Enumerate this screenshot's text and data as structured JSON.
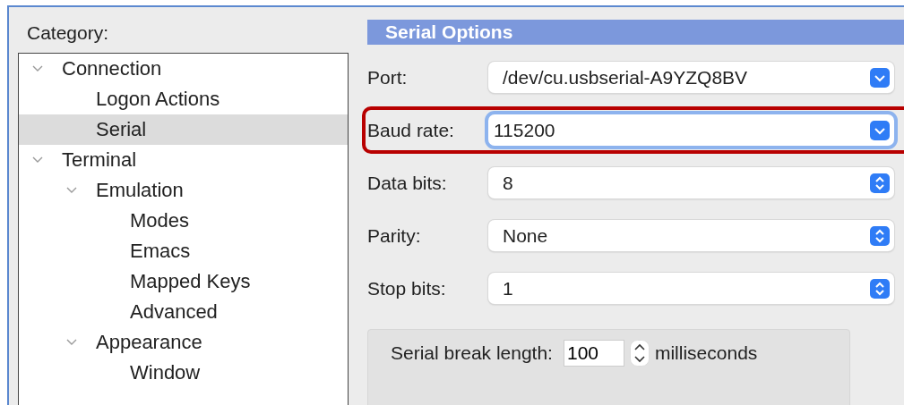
{
  "category": {
    "label": "Category:",
    "tree": [
      {
        "label": "Connection",
        "expanded": true,
        "selected": false,
        "children": [
          {
            "label": "Logon Actions",
            "selected": false
          },
          {
            "label": "Serial",
            "selected": true
          }
        ]
      },
      {
        "label": "Terminal",
        "expanded": true,
        "selected": false,
        "children": [
          {
            "label": "Emulation",
            "expanded": true,
            "selected": false,
            "children": [
              {
                "label": "Modes",
                "selected": false
              },
              {
                "label": "Emacs",
                "selected": false
              },
              {
                "label": "Mapped Keys",
                "selected": false
              },
              {
                "label": "Advanced",
                "selected": false
              }
            ]
          },
          {
            "label": "Appearance",
            "expanded": true,
            "selected": false,
            "children": [
              {
                "label": "Window",
                "selected": false
              }
            ]
          }
        ]
      }
    ]
  },
  "panel": {
    "title": "Serial Options",
    "fields": [
      {
        "label": "Port:",
        "value": "/dev/cu.usbserial-A9YZQ8BV",
        "kind": "combo",
        "focused": false,
        "highlighted": false
      },
      {
        "label": "Baud rate:",
        "value": "115200",
        "kind": "combo",
        "focused": true,
        "highlighted": true
      },
      {
        "label": "Data bits:",
        "value": "8",
        "kind": "popup",
        "focused": false,
        "highlighted": false
      },
      {
        "label": "Parity:",
        "value": "None",
        "kind": "popup",
        "focused": false,
        "highlighted": false
      },
      {
        "label": "Stop bits:",
        "value": "1",
        "kind": "popup",
        "focused": false,
        "highlighted": false
      }
    ],
    "break_group": {
      "label": "Serial break length:",
      "value": "100",
      "unit": "milliseconds"
    }
  }
}
